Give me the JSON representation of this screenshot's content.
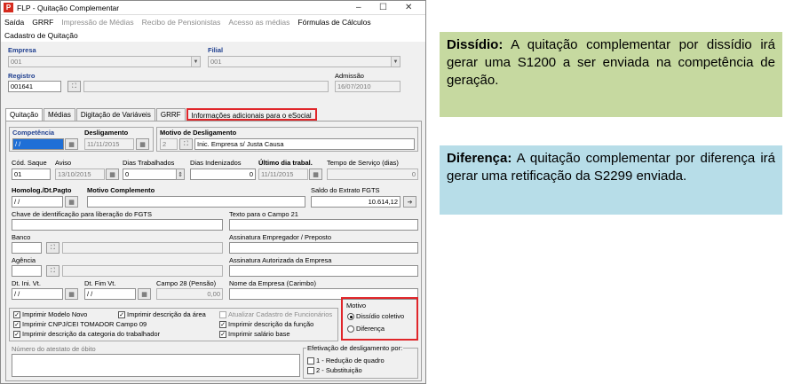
{
  "window": {
    "title": "FLP - Quitação Complementar",
    "app_icon_letter": "P",
    "min": "–",
    "max": "☐",
    "close": "✕"
  },
  "menu": [
    {
      "label": "Saída",
      "disabled": false
    },
    {
      "label": "GRRF",
      "disabled": false
    },
    {
      "label": "Impressão de Médias",
      "disabled": true
    },
    {
      "label": "Recibo de Pensionistas",
      "disabled": true
    },
    {
      "label": "Acesso as médias",
      "disabled": true
    },
    {
      "label": "Fórmulas de Cálculos",
      "disabled": false
    },
    {
      "label": "Cadastro de Quitação",
      "disabled": false
    }
  ],
  "header": {
    "empresa_label": "Empresa",
    "empresa_value": "001",
    "filial_label": "Filial",
    "filial_value": "001",
    "registro_label": "Registro",
    "registro_value": "001641",
    "admissao_label": "Admissão",
    "admissao_value": "16/07/2010"
  },
  "tabs": [
    "Quitação",
    "Médias",
    "Digitação de Variáveis",
    "GRRF",
    "Informações adicionais para o eSocial"
  ],
  "form": {
    "competencia_label": "Competência",
    "competencia_value": " / /",
    "desligamento_label": "Desligamento",
    "desligamento_value": "11/11/2015",
    "motivo_desl_label": "Motivo de Desligamento",
    "motivo_desl_code": "2",
    "motivo_desl_desc": "Inic. Empresa s/ Justa Causa",
    "cod_saque_label": "Cód. Saque",
    "cod_saque_value": "01",
    "aviso_label": "Aviso",
    "aviso_value": "13/10/2015",
    "dias_trab_label": "Dias Trabalhados",
    "dias_trab_value": "0",
    "dias_inden_label": "Dias Indenizados",
    "dias_inden_value": "0",
    "ultimo_dia_label": "Último dia trabal.",
    "ultimo_dia_value": "11/11/2015",
    "tempo_servico_label": "Tempo de Serviço (dias)",
    "tempo_servico_value": "0",
    "homolog_label": "Homolog./Dt.Pagto",
    "homolog_value": " / /",
    "motivo_compl_label": "Motivo Complemento",
    "saldo_label": "Saldo do Extrato FGTS",
    "saldo_value": "10.614,12",
    "chave_label": "Chave de identificação para liberação do FGTS",
    "texto21_label": "Texto para o Campo 21",
    "banco_label": "Banco",
    "assin_emp_label": "Assinatura Empregador / Preposto",
    "agencia_label": "Agência",
    "assin_aut_label": "Assinatura Autorizada da Empresa",
    "dt_ini_label": "Dt. Ini. Vt.",
    "dt_ini_value": " / /",
    "dt_fim_label": "Dt. Fim Vt.",
    "dt_fim_value": " / /",
    "campo28_label": "Campo 28 (Pensão)",
    "campo28_value": "0,00",
    "nome_emp_label": "Nome da Empresa (Carimbo)",
    "obito_label": "Número do atestato de óbito"
  },
  "checks": {
    "modelo_novo": "Imprimir Modelo Novo",
    "desc_area": "Imprimir descrição da área",
    "atualizar": "Atualizar Cadastro de Funcionários",
    "cnpj": "Imprimir CNPJ/CEI TOMADOR Campo 09",
    "desc_funcao": "Imprimir descrição da função",
    "desc_cat": "Imprimir descrição da categoria do trabalhador",
    "salario": "Imprimir salário base"
  },
  "motivo": {
    "title": "Motivo",
    "opt1": "Dissídio coletivo",
    "opt2": "Diferença"
  },
  "efetivacao": {
    "title": "Efetivação de desligamento por:",
    "opt1": "1 - Redução de quadro",
    "opt2": "2 - Substituição"
  },
  "notes": {
    "dissidio_title": "Dissídio:",
    "dissidio_text": " A quitação complementar por dissídio irá gerar uma S1200 a ser enviada na competência de geração.",
    "diferenca_title": "Diferença:",
    "diferenca_text": " A quitação complementar por diferença irá gerar uma retificação da S2299 enviada.",
    "dissidio_bg": "#c6d9a0",
    "diferenca_bg": "#b7dde8"
  },
  "colors": {
    "highlight": "#e0262a",
    "label_blue": "#1f3f8f"
  }
}
